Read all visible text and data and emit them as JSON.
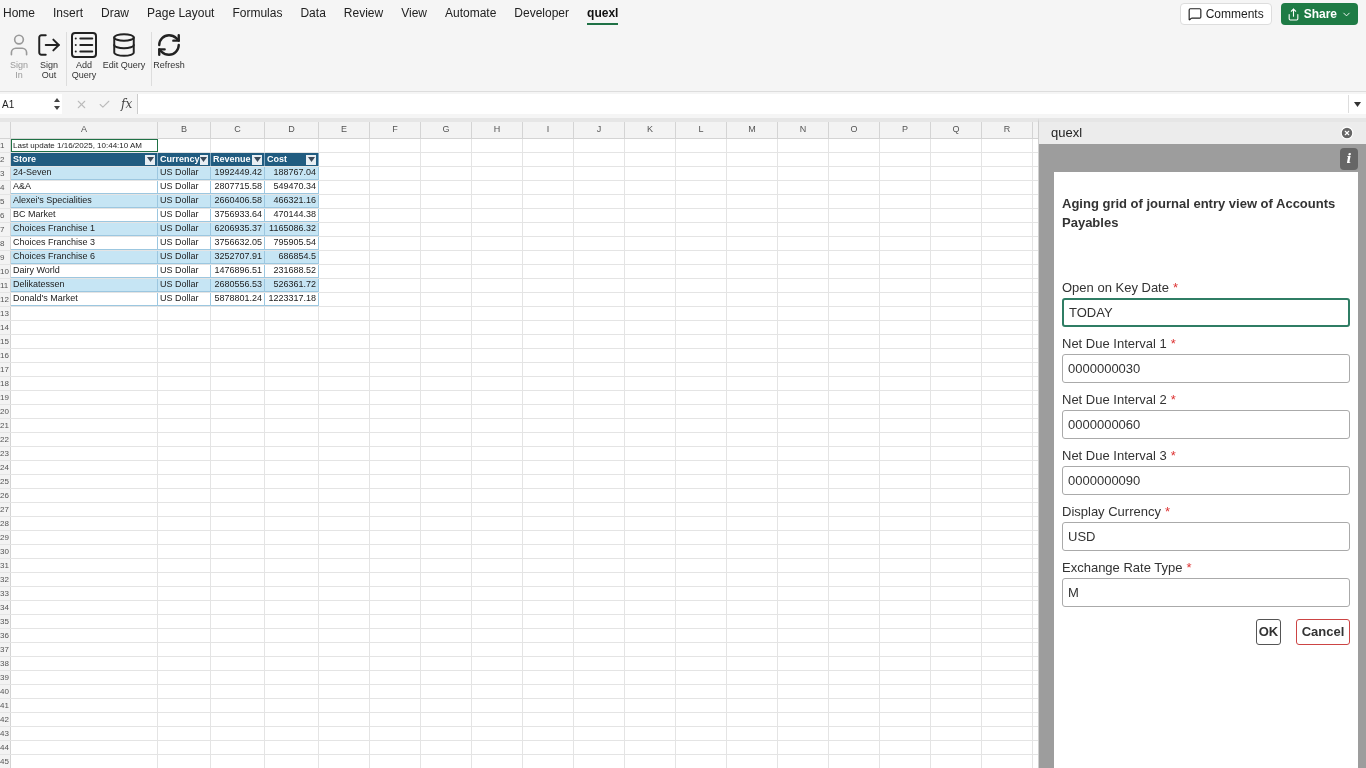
{
  "ribbon_tabs": [
    {
      "label": "Home",
      "selected": false
    },
    {
      "label": "Insert",
      "selected": false
    },
    {
      "label": "Draw",
      "selected": false
    },
    {
      "label": "Page Layout",
      "selected": false
    },
    {
      "label": "Formulas",
      "selected": false
    },
    {
      "label": "Data",
      "selected": false
    },
    {
      "label": "Review",
      "selected": false
    },
    {
      "label": "View",
      "selected": false
    },
    {
      "label": "Automate",
      "selected": false
    },
    {
      "label": "Developer",
      "selected": false
    },
    {
      "label": "quexl",
      "selected": true
    }
  ],
  "header_buttons": {
    "comments": "Comments",
    "share": "Share"
  },
  "ribbon_groups": [
    [
      {
        "label": "Sign In",
        "disabled": true
      },
      {
        "label": "Sign Out",
        "disabled": false
      }
    ],
    [
      {
        "label": "Add Query",
        "disabled": false
      },
      {
        "label": "Edit Query",
        "disabled": false
      }
    ],
    [
      {
        "label": "Refresh",
        "disabled": false
      }
    ]
  ],
  "formula_bar": {
    "cell_ref": "A1",
    "fx": "fx"
  },
  "sheet": {
    "columns": [
      "A",
      "B",
      "C",
      "D",
      "E",
      "F",
      "G",
      "H",
      "I",
      "J",
      "K",
      "L",
      "M",
      "N",
      "O",
      "P",
      "Q",
      "R"
    ],
    "row_numbers": [
      "1",
      "2",
      "3",
      "4",
      "5",
      "6",
      "7",
      "8",
      "9",
      "10",
      "11",
      "12",
      "13",
      "14",
      "15",
      "16",
      "17",
      "18",
      "19",
      "20",
      "21",
      "22",
      "23",
      "24",
      "25",
      "26",
      "27",
      "28",
      "29",
      "30",
      "31",
      "32",
      "33",
      "34",
      "35",
      "36",
      "37",
      "38",
      "39",
      "40",
      "41",
      "42",
      "43",
      "44",
      "45"
    ],
    "info": "Last update 1/16/2025, 10:44:10 AM",
    "table": {
      "columns": [
        "Store",
        "Currency",
        "Revenue",
        "Cost"
      ],
      "rows": [
        [
          "24-Seven",
          "US Dollar",
          "1992449.42",
          "188767.04"
        ],
        [
          "A&A",
          "US Dollar",
          "2807715.58",
          "549470.34"
        ],
        [
          "Alexei's Specialities",
          "US Dollar",
          "2660406.58",
          "466321.16"
        ],
        [
          "BC Market",
          "US Dollar",
          "3756933.64",
          "470144.38"
        ],
        [
          "Choices Franchise 1",
          "US Dollar",
          "6206935.37",
          "1165086.32"
        ],
        [
          "Choices Franchise 3",
          "US Dollar",
          "3756632.05",
          "795905.54"
        ],
        [
          "Choices Franchise 6",
          "US Dollar",
          "3252707.91",
          "686854.5"
        ],
        [
          "Dairy World",
          "US Dollar",
          "1476896.51",
          "231688.52"
        ],
        [
          "Delikatessen",
          "US Dollar",
          "2680556.53",
          "526361.72"
        ],
        [
          "Donald's Market",
          "US Dollar",
          "5878801.24",
          "1223317.18"
        ]
      ]
    }
  },
  "pane": {
    "title": "quexl",
    "info": "i",
    "heading": "Aging grid of journal entry view of Accounts Payables",
    "fields": [
      {
        "label": "Open on Key Date",
        "value": "TODAY",
        "required_mark": "*",
        "focused": true
      },
      {
        "label": "Net Due Interval 1",
        "value": "0000000030",
        "required_mark": "*",
        "focused": false
      },
      {
        "label": "Net Due Interval 2",
        "value": "0000000060",
        "required_mark": "*",
        "focused": false
      },
      {
        "label": "Net Due Interval 3",
        "value": "0000000090",
        "required_mark": "*",
        "focused": false
      },
      {
        "label": "Display Currency",
        "value": "USD",
        "required_mark": "*",
        "focused": false
      },
      {
        "label": "Exchange Rate Type",
        "value": "M",
        "required_mark": "*",
        "focused": false
      }
    ],
    "buttons": [
      {
        "label": "OK",
        "kind": "primary"
      },
      {
        "label": "Cancel",
        "kind": "danger"
      }
    ]
  }
}
